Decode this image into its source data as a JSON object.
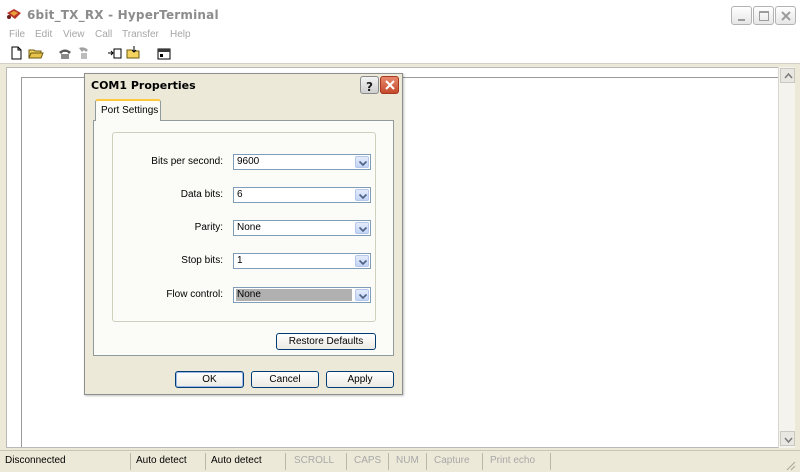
{
  "window": {
    "title": "6bit_TX_RX - HyperTerminal",
    "icon": "hyperterminal-app-icon"
  },
  "menu": [
    "File",
    "Edit",
    "View",
    "Call",
    "Transfer",
    "Help"
  ],
  "toolbar": {
    "icons": [
      "new-file-icon",
      "open-folder-icon",
      "call-phone-icon",
      "hang-up-icon",
      "send-icon",
      "receive-icon",
      "properties-icon"
    ]
  },
  "dialog": {
    "title": "COM1 Properties",
    "tab": "Port Settings",
    "fields": [
      {
        "label": "Bits per second:",
        "value": "9600"
      },
      {
        "label": "Data bits:",
        "value": "6"
      },
      {
        "label": "Parity:",
        "value": "None"
      },
      {
        "label": "Stop bits:",
        "value": "1"
      },
      {
        "label": "Flow control:",
        "value": "None"
      }
    ],
    "restore_label": "Restore Defaults",
    "ok_label": "OK",
    "cancel_label": "Cancel",
    "apply_label": "Apply"
  },
  "statusbar": {
    "connection": "Disconnected",
    "terminal": "Auto detect",
    "settings": "Auto detect",
    "scroll": "SCROLL",
    "caps": "CAPS",
    "num": "NUM",
    "capture": "Capture",
    "print_echo": "Print echo"
  },
  "colors": {
    "accent_tab": "#ffc83c",
    "close_red": "#c54a2c",
    "button_border": "#003c74"
  }
}
